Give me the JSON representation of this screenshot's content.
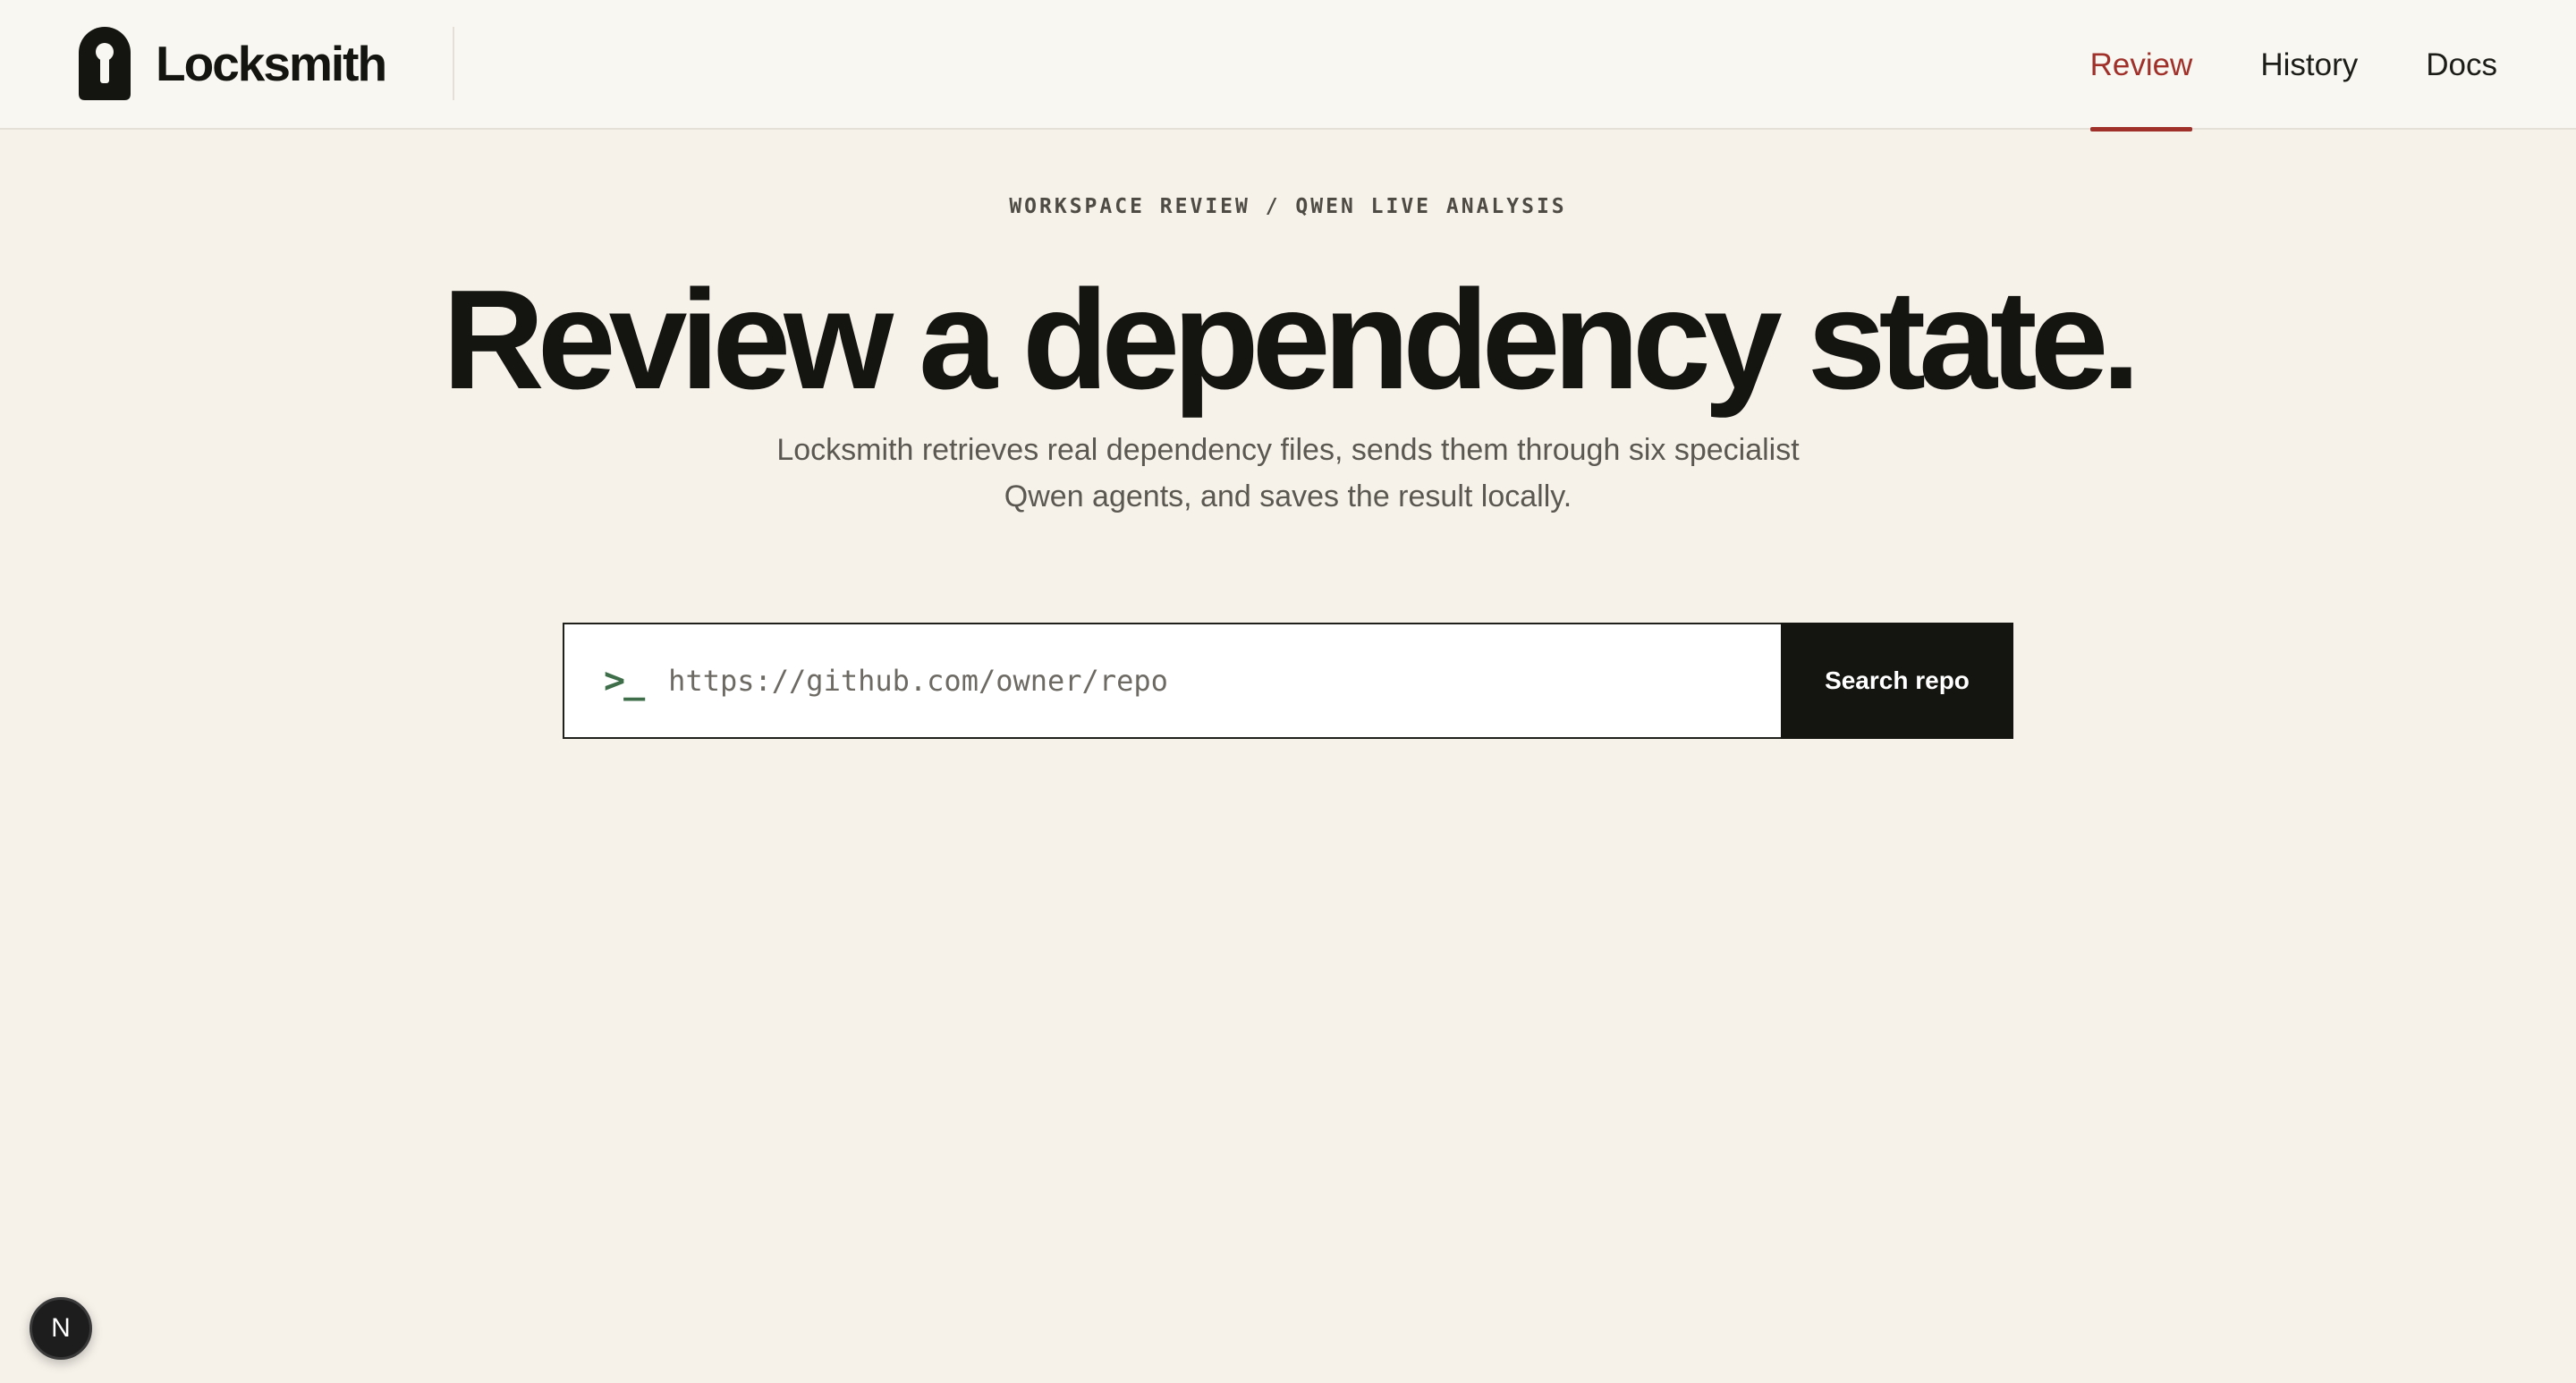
{
  "header": {
    "brand_name": "Locksmith",
    "nav": [
      {
        "label": "Review",
        "active": true
      },
      {
        "label": "History",
        "active": false
      },
      {
        "label": "Docs",
        "active": false
      }
    ]
  },
  "hero": {
    "eyebrow": "WORKSPACE REVIEW / QWEN LIVE ANALYSIS",
    "headline": "Review a dependency state.",
    "subtitle_line1": "Locksmith retrieves real dependency files, sends them through six specialist",
    "subtitle_line2": "Qwen agents, and saves the result locally."
  },
  "search": {
    "prompt_glyph": ">_",
    "placeholder": "https://github.com/owner/repo",
    "value": "",
    "button_label": "Search repo"
  },
  "dev_badge": {
    "label": "N"
  },
  "colors": {
    "background": "#f6f2ea",
    "header_background": "#f9f7f2",
    "accent": "#a0302a",
    "prompt": "#3e6f4a",
    "button": "#141410"
  },
  "icons": {
    "brand": "keyhole-icon",
    "prompt": "terminal-prompt-icon"
  }
}
